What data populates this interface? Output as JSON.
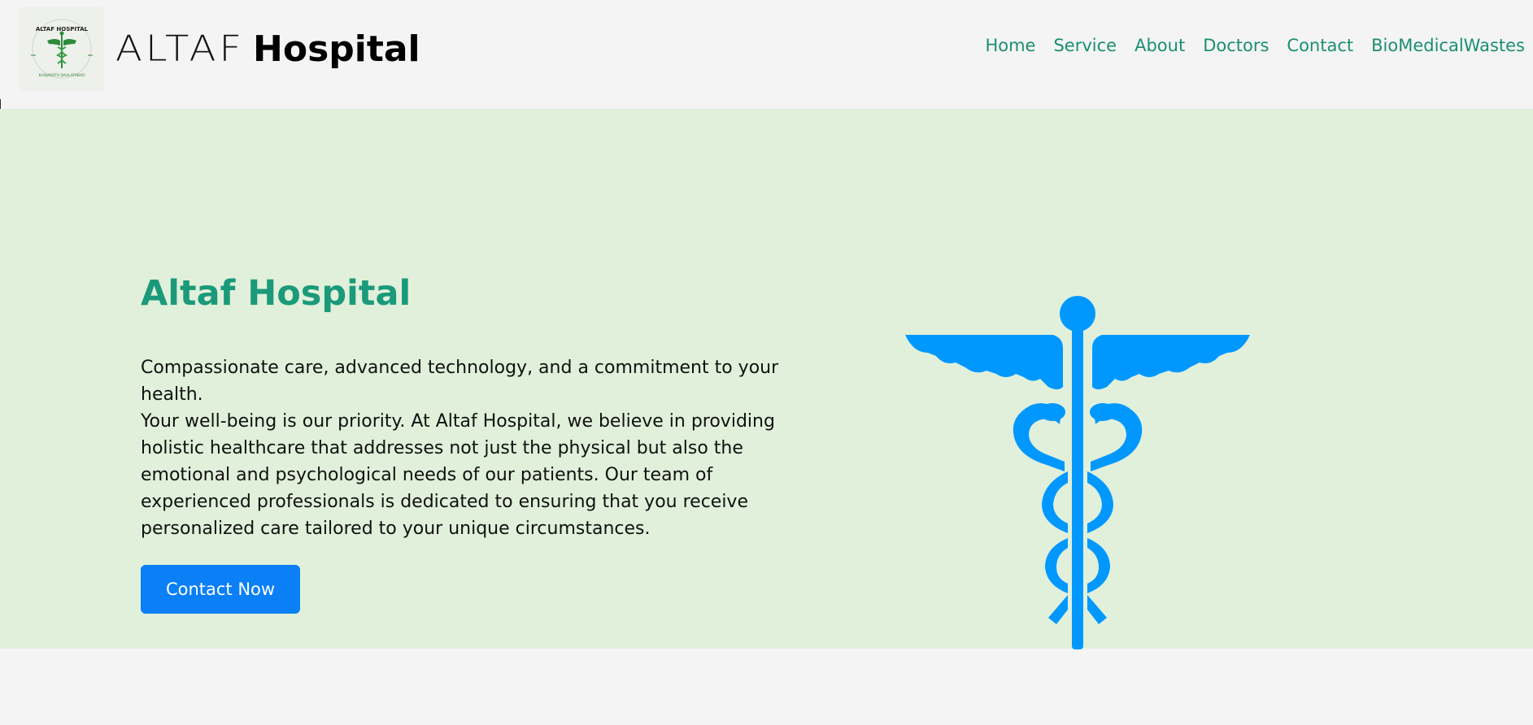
{
  "header": {
    "logo": {
      "alt_text": "ALTAF HOSPITAL",
      "subtext": "KHAJAKOTA DAULATABAD"
    },
    "brand": {
      "light": "ALTAF",
      "bold": "Hospital"
    },
    "nav": [
      {
        "label": "Home"
      },
      {
        "label": "Service"
      },
      {
        "label": "About"
      },
      {
        "label": "Doctors"
      },
      {
        "label": "Contact"
      },
      {
        "label": "BioMedicalWastes"
      }
    ]
  },
  "hero": {
    "title": "Altaf Hospital",
    "paragraph_1": "Compassionate care, advanced technology, and a commitment to your health.",
    "paragraph_2": "Your well-being is our priority. At Altaf Hospital, we believe in providing holistic healthcare that addresses not just the physical but also the emotional and psychological needs of our patients. Our team of experienced professionals is dedicated to ensuring that you receive personalized care tailored to your unique circumstances.",
    "button_label": "Contact Now",
    "image_icon": "caduceus-icon"
  },
  "colors": {
    "page_bg": "#f4f4f4",
    "hero_bg": "#e0f0da",
    "nav_link": "#1a8f6e",
    "hero_title": "#1a9a7a",
    "button_bg": "#0b7ff5",
    "caduceus": "#0098ff"
  }
}
